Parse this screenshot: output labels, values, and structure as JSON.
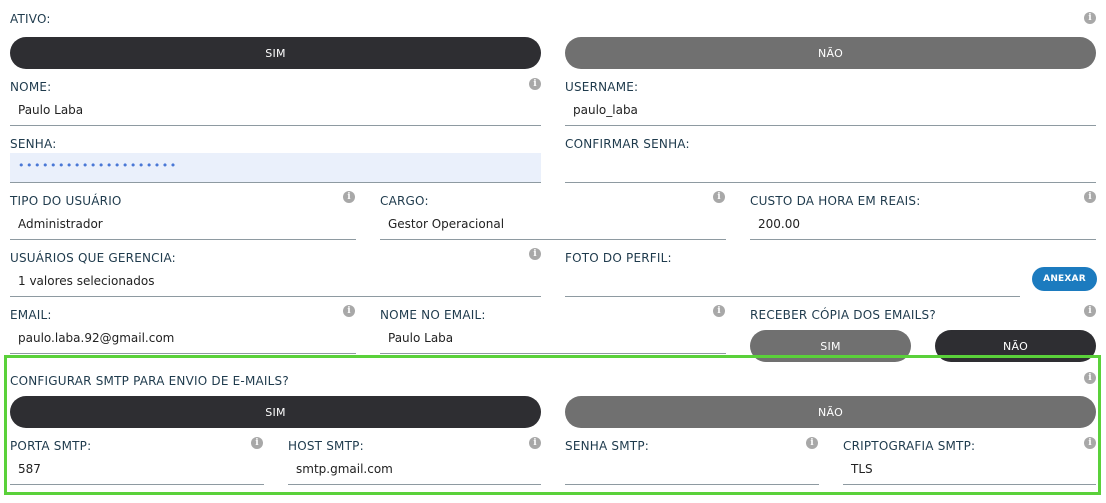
{
  "ativo": {
    "label": "ATIVO:",
    "sim": "SIM",
    "nao": "NÃO"
  },
  "nome": {
    "label": "NOME:",
    "value": "Paulo Laba"
  },
  "username": {
    "label": "USERNAME:",
    "value": "paulo_laba"
  },
  "senha": {
    "label": "SENHA:",
    "value": "••••••••••••••••••••"
  },
  "confirmar_senha": {
    "label": "CONFIRMAR SENHA:",
    "value": ""
  },
  "tipo_usuario": {
    "label": "TIPO DO USUÁRIO",
    "value": "Administrador"
  },
  "cargo": {
    "label": "CARGO:",
    "value": "Gestor Operacional"
  },
  "custo_hora": {
    "label": "CUSTO DA HORA EM REAIS:",
    "value": "200.00"
  },
  "usuarios_gerencia": {
    "label": "USUÁRIOS QUE GERENCIA:",
    "value": "1 valores selecionados"
  },
  "foto_perfil": {
    "label": "FOTO DO PERFIL:",
    "button": "ANEXAR"
  },
  "email": {
    "label": "EMAIL:",
    "value": "paulo.laba.92@gmail.com"
  },
  "nome_email": {
    "label": "NOME NO EMAIL:",
    "value": "Paulo Laba"
  },
  "receber_copia": {
    "label": "RECEBER CÓPIA DOS EMAILS?",
    "sim": "SIM",
    "nao": "NÃO"
  },
  "smtp": {
    "label": "CONFIGURAR SMTP PARA ENVIO DE E-MAILS?",
    "sim": "SIM",
    "nao": "NÃO"
  },
  "porta_smtp": {
    "label": "PORTA SMTP:",
    "value": "587"
  },
  "host_smtp": {
    "label": "HOST SMTP:",
    "value": "smtp.gmail.com"
  },
  "senha_smtp": {
    "label": "SENHA SMTP:",
    "value": ""
  },
  "cripto_smtp": {
    "label": "CRIPTOGRAFIA SMTP:",
    "value": "TLS"
  },
  "info_icon_glyph": "i",
  "colors": {
    "dark_toggle": "#2e2e32",
    "grey_toggle": "#707070",
    "accent": "#1c7bbf",
    "highlight": "#5ad13a"
  }
}
